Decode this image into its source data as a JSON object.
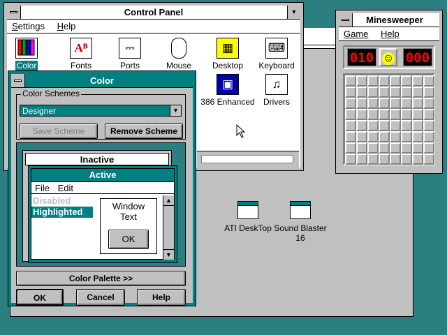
{
  "control_panel": {
    "title": "Control Panel",
    "menu": [
      "Settings",
      "Help"
    ],
    "icons": [
      {
        "label": "Color",
        "icon": "color-icon",
        "glyph": "✎"
      },
      {
        "label": "Fonts",
        "icon": "fonts-icon",
        "glyph": "Aᴮ"
      },
      {
        "label": "Ports",
        "icon": "ports-icon",
        "glyph": "⎓"
      },
      {
        "label": "Mouse",
        "icon": "mouse-icon",
        "glyph": "🖱"
      },
      {
        "label": "Desktop",
        "icon": "desktop-icon",
        "glyph": "▦"
      },
      {
        "label": "Keyboard",
        "icon": "keyboard-icon",
        "glyph": "⌨"
      },
      {
        "label": "386 Enhanced",
        "icon": "chip-icon",
        "glyph": "▣"
      },
      {
        "label": "Drivers",
        "icon": "drivers-icon",
        "glyph": "♫"
      }
    ]
  },
  "color_dialog": {
    "title": "Color",
    "schemes_label": "Color Schemes",
    "scheme_value": "Designer",
    "save_scheme": "Save Scheme",
    "remove_scheme": "Remove Scheme",
    "preview": {
      "inactive_title": "Inactive",
      "active_title": "Active",
      "menu": [
        "File",
        "Edit"
      ],
      "disabled": "Disabled",
      "highlighted": "Highlighted",
      "window_text_line1": "Window",
      "window_text_line2": "Text",
      "ok": "OK"
    },
    "palette_button": "Color Palette >>",
    "ok": "OK",
    "cancel": "Cancel",
    "help": "Help"
  },
  "minesweeper": {
    "title": "Minesweeper",
    "menu": [
      "Game",
      "Help"
    ],
    "mines_left": "010",
    "timer": "000",
    "face": "☺",
    "rows": 8,
    "cols": 8
  },
  "desktop_icons": [
    {
      "label_line1": "ATI DeskTop",
      "label_line2": ""
    },
    {
      "label_line1": "Sound Blaster",
      "label_line2": "16"
    }
  ],
  "colors": {
    "desktop": "#2b7f80",
    "active_title": "#008080",
    "face": "#c0c0c0",
    "highlight": "#008080"
  }
}
